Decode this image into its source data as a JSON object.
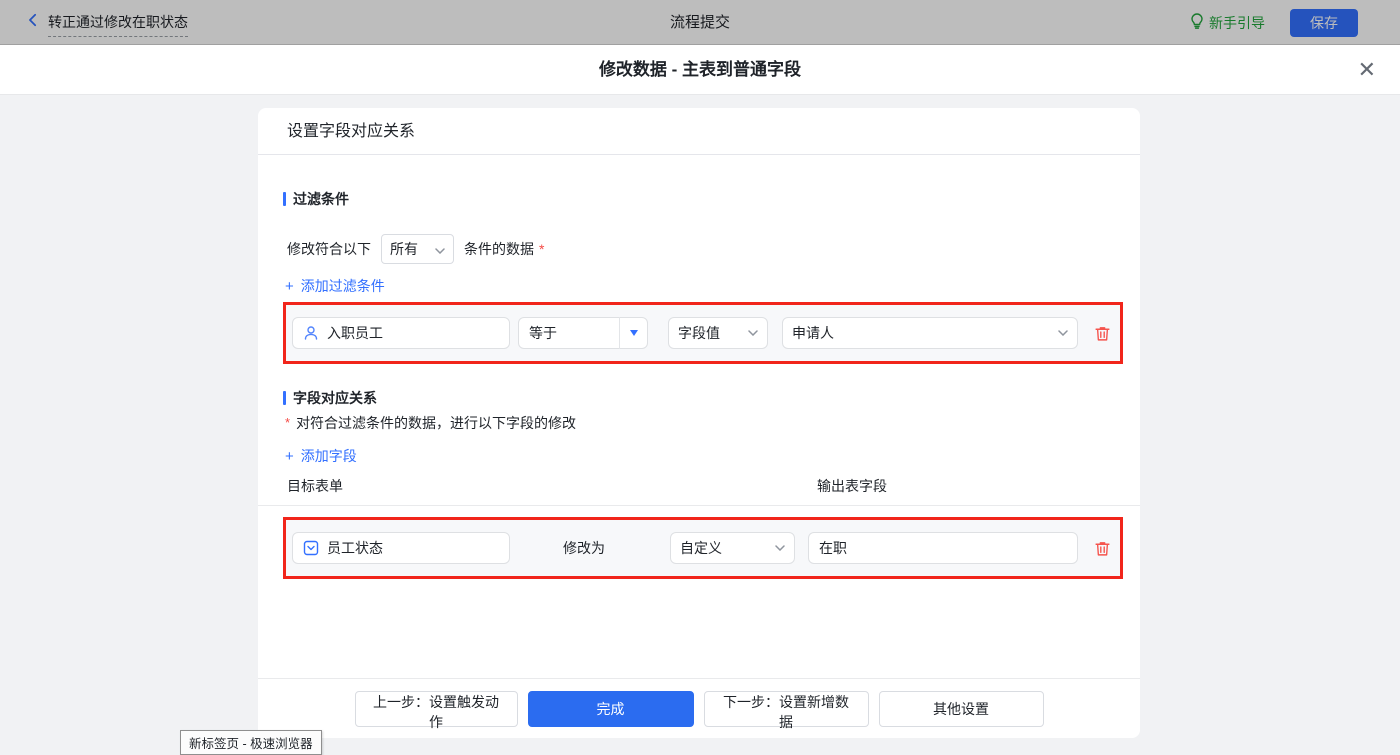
{
  "topbar": {
    "flow_name": "转正通过修改在职状态",
    "center_title": "流程提交",
    "guide_label": "新手引导",
    "save_label": "保存"
  },
  "dialog": {
    "title": "修改数据 - 主表到普通字段",
    "close_glyph": "✕"
  },
  "panel": {
    "header": "设置字段对应关系",
    "filter_section": {
      "title": "过滤条件",
      "prefix": "修改符合以下",
      "match_select_value": "所有",
      "suffix": "条件的数据",
      "required_mark": "*",
      "add_icon": "+",
      "add_link": "添加过滤条件",
      "condition_row": {
        "field_value": "入职员工",
        "operator_value": "等于",
        "value_type_value": "字段值",
        "value_value": "申请人"
      }
    },
    "mapping_section": {
      "title": "字段对应关系",
      "required_mark": "*",
      "desc": "对符合过滤条件的数据，进行以下字段的修改",
      "add_icon": "+",
      "add_link": "添加字段",
      "col_target": "目标表单",
      "col_output": "输出表字段",
      "row": {
        "field_value": "员工状态",
        "action_label": "修改为",
        "mode_value": "自定义",
        "value_value": "在职"
      }
    },
    "footer": {
      "prev_label": "上一步：设置触发动作",
      "done_label": "完成",
      "next_label": "下一步：设置新增数据",
      "other_label": "其他设置"
    }
  },
  "browser_tooltip": "新标签页 - 极速浏览器",
  "colors": {
    "accent_blue": "#3370ff",
    "primary_button_blue": "#2b6cf0",
    "highlight_red": "#f1251b",
    "danger_icon_red": "#f5544d",
    "guide_green": "#21a53c",
    "body_gray": "#f1f2f4"
  }
}
